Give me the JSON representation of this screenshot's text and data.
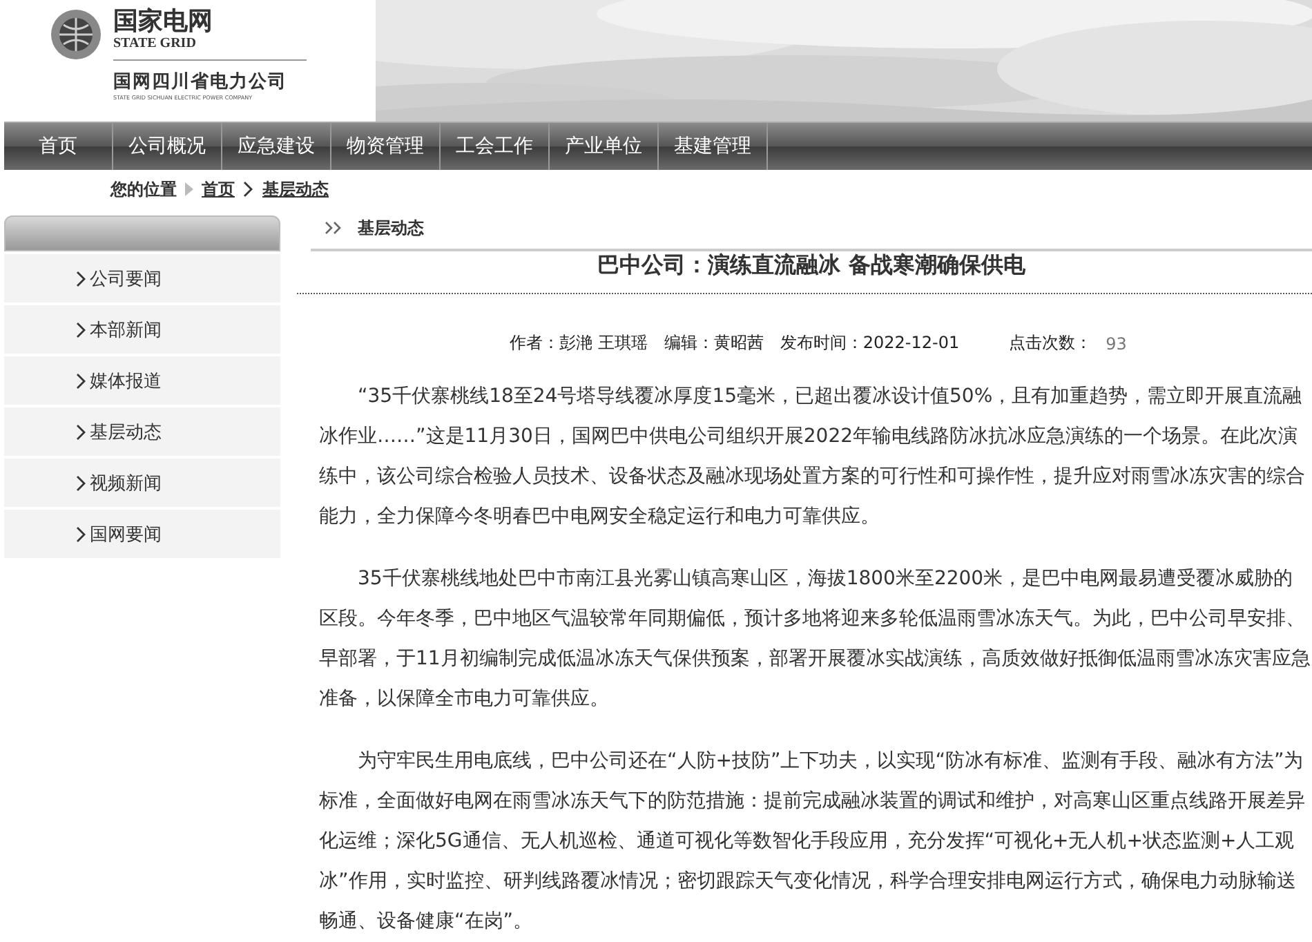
{
  "header": {
    "logo_title": "国家电网",
    "logo_subtitle": "STATE GRID",
    "company": "国网四川省电力公司",
    "company_en": "STATE GRID SICHUAN ELECTRIC POWER COMPANY"
  },
  "nav": [
    {
      "label": "首页",
      "selected": false
    },
    {
      "label": "公司概况",
      "selected": false
    },
    {
      "label": "应急建设",
      "selected": false
    },
    {
      "label": "物资管理",
      "selected": false
    },
    {
      "label": "工会工作",
      "selected": false
    },
    {
      "label": "产业单位",
      "selected": false
    },
    {
      "label": "基建管理",
      "selected": false
    }
  ],
  "breadcrumb": {
    "label": "您的位置",
    "items": [
      "首页",
      "基层动态"
    ]
  },
  "sidebar": {
    "items": [
      {
        "label": "公司要闻",
        "selected": false
      },
      {
        "label": "本部新闻",
        "selected": false
      },
      {
        "label": "媒体报道",
        "selected": false
      },
      {
        "label": "基层动态",
        "selected": false
      },
      {
        "label": "视频新闻",
        "selected": false
      },
      {
        "label": "国网要闻",
        "selected": false
      }
    ]
  },
  "article": {
    "section": "基层动态",
    "title": "巴中公司：演练直流融冰 备战寒潮确保供电",
    "meta": "作者：彭滟 王琪瑶　编辑：黄昭茜　发布时间：2022-12-01",
    "hits_label": "点击次数：",
    "hits": "93",
    "paragraphs": [
      "“35千伏寨桃线18至24号塔导线覆冰厚度15毫米，已超出覆冰设计值50%，且有加重趋势，需立即开展直流融冰作业……”这是11月30日，国网巴中供电公司组织开展2022年输电线路防冰抗冰应急演练的一个场景。在此次演练中，该公司综合检验人员技术、设备状态及融冰现场处置方案的可行性和可操作性，提升应对雨雪冰冻灾害的综合能力，全力保障今冬明春巴中电网安全稳定运行和电力可靠供应。",
      "35千伏寨桃线地处巴中市南江县光雾山镇高寒山区，海拔1800米至2200米，是巴中电网最易遭受覆冰威胁的区段。今年冬季，巴中地区气温较常年同期偏低，预计多地将迎来多轮低温雨雪冰冻天气。为此，巴中公司早安排、早部署，于11月初编制完成低温冰冻天气保供预案，部署开展覆冰实战演练，高质效做好抵御低温雨雪冰冻灾害应急准备，以保障全市电力可靠供应。",
      "为守牢民生用电底线，巴中公司还在“人防+技防”上下功夫，以实现“防冰有标准、监测有手段、融冰有方法”为标准，全面做好电网在雨雪冰冻天气下的防范措施：提前完成融冰装置的调试和维护，对高寒山区重点线路开展差异化运维；深化5G通信、无人机巡检、通道可视化等数智化手段应用，充分发挥“可视化+无人机+状态监测+人工观冰”作用，实时监控、研判线路覆冰情况；密切跟踪天气变化情况，科学合理安排电网运行方式，确保电力动脉输送畅通、设备健康“在岗”。"
    ]
  }
}
